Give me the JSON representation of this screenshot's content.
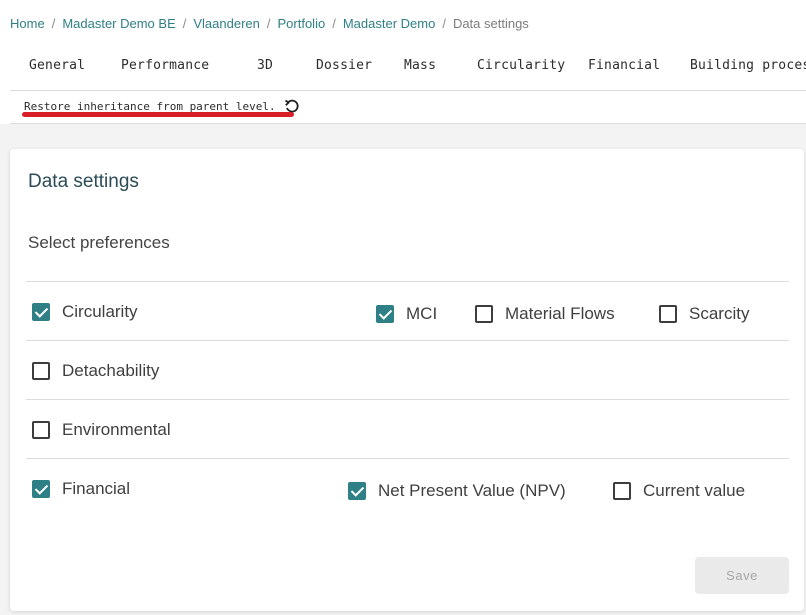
{
  "breadcrumb": {
    "items": [
      "Home",
      "Madaster Demo BE",
      "Vlaanderen",
      "Portfolio",
      "Madaster Demo"
    ],
    "current": "Data settings",
    "separator": "/"
  },
  "tabs": [
    "General",
    "Performance",
    "3D",
    "Dossier",
    "Mass",
    "Circularity",
    "Financial",
    "Building process"
  ],
  "restore": {
    "label": "Restore inheritance from parent level.",
    "icon": "restore-icon"
  },
  "card": {
    "title": "Data settings",
    "subtitle": "Select preferences"
  },
  "preferences": {
    "circularity": {
      "label": "Circularity",
      "checked": true
    },
    "mci": {
      "label": "MCI",
      "checked": true
    },
    "material_flows": {
      "label": "Material Flows",
      "checked": false
    },
    "scarcity": {
      "label": "Scarcity",
      "checked": false
    },
    "detachability": {
      "label": "Detachability",
      "checked": false
    },
    "environmental": {
      "label": "Environmental",
      "checked": false
    },
    "financial": {
      "label": "Financial",
      "checked": true
    },
    "npv": {
      "label": "Net Present Value (NPV)",
      "checked": true
    },
    "current_value": {
      "label": "Current value",
      "checked": false
    }
  },
  "save_label": "Save",
  "colors": {
    "accent": "#2f7f86",
    "highlight_underline": "#d81f26"
  }
}
